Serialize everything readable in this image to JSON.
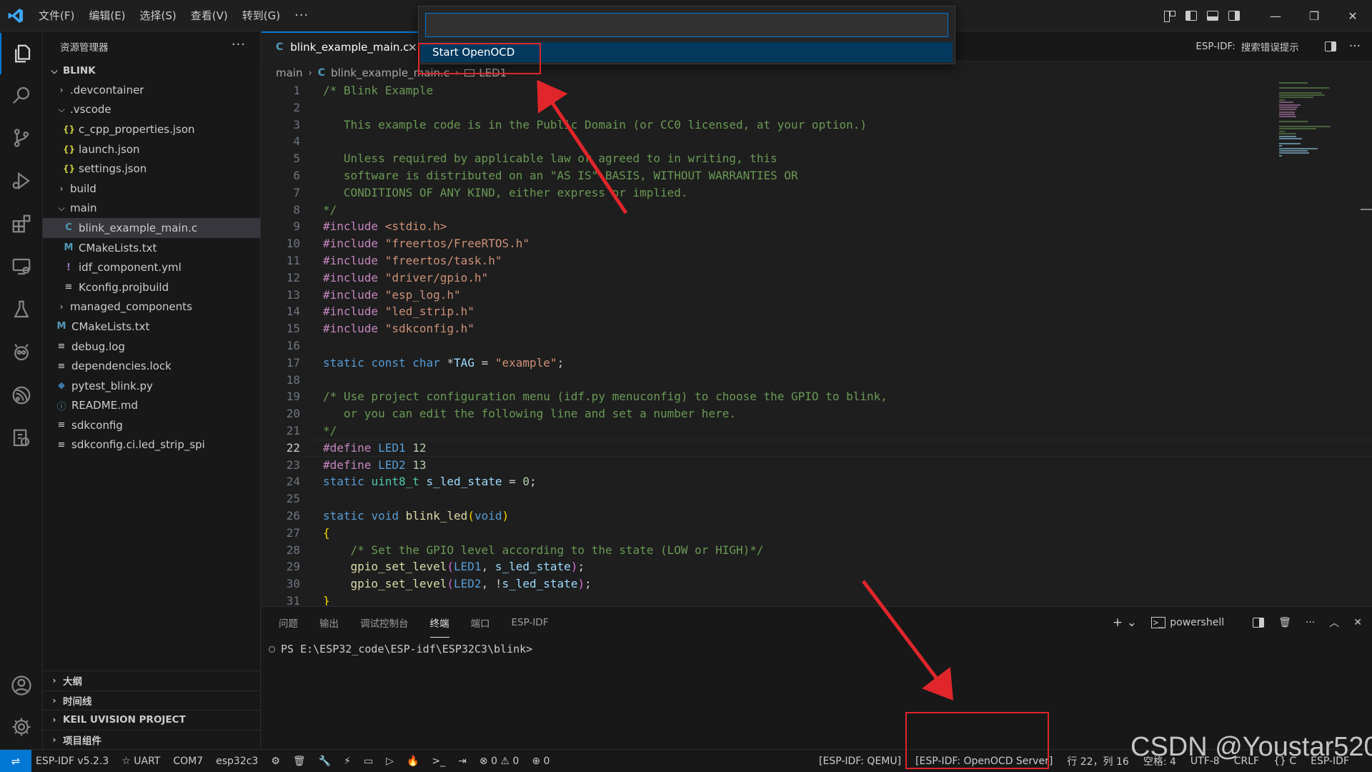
{
  "titlebar": {
    "menu": [
      "文件(F)",
      "编辑(E)",
      "选择(S)",
      "查看(V)",
      "转到(G)",
      "···"
    ],
    "window_controls": [
      "—",
      "❐",
      "✕"
    ]
  },
  "palette": {
    "input_value": "",
    "item": "Start OpenOCD"
  },
  "sidebar": {
    "title": "资源管理器",
    "more": "···",
    "root": "BLINK",
    "tree": [
      {
        "label": ".devcontainer",
        "type": "folder",
        "depth": 1,
        "open": false
      },
      {
        "label": ".vscode",
        "type": "folder",
        "depth": 1,
        "open": true
      },
      {
        "label": "c_cpp_properties.json",
        "type": "json",
        "depth": 2
      },
      {
        "label": "launch.json",
        "type": "json",
        "depth": 2
      },
      {
        "label": "settings.json",
        "type": "json",
        "depth": 2
      },
      {
        "label": "build",
        "type": "folder",
        "depth": 1,
        "open": false
      },
      {
        "label": "main",
        "type": "folder",
        "depth": 1,
        "open": true
      },
      {
        "label": "blink_example_main.c",
        "type": "c",
        "depth": 2,
        "selected": true
      },
      {
        "label": "CMakeLists.txt",
        "type": "m",
        "depth": 2
      },
      {
        "label": "idf_component.yml",
        "type": "y",
        "depth": 2
      },
      {
        "label": "Kconfig.projbuild",
        "type": "txt",
        "depth": 2
      },
      {
        "label": "managed_components",
        "type": "folder",
        "depth": 1,
        "open": false
      },
      {
        "label": "CMakeLists.txt",
        "type": "m",
        "depth": 1
      },
      {
        "label": "debug.log",
        "type": "txt",
        "depth": 1
      },
      {
        "label": "dependencies.lock",
        "type": "txt",
        "depth": 1
      },
      {
        "label": "pytest_blink.py",
        "type": "py",
        "depth": 1
      },
      {
        "label": "README.md",
        "type": "info",
        "depth": 1
      },
      {
        "label": "sdkconfig",
        "type": "txt",
        "depth": 1
      },
      {
        "label": "sdkconfig.ci.led_strip_spi",
        "type": "txt",
        "depth": 1
      }
    ],
    "bottom_sections": [
      "大纲",
      "时间线",
      "KEIL UVISION PROJECT",
      "项目组件"
    ]
  },
  "editor": {
    "tab": {
      "icon": "C",
      "label": "blink_example_main.c",
      "close": "✕"
    },
    "tab_right": {
      "label": "ESP-IDF:",
      "action": "搜索错误提示",
      "more": "···"
    },
    "breadcrumb": [
      "main",
      "blink_example_main.c",
      "LED1"
    ],
    "current_line": 22,
    "lines": [
      {
        "n": "1",
        "html": "<span class=\"cm\">/* Blink Example</span>"
      },
      {
        "n": "2",
        "html": ""
      },
      {
        "n": "3",
        "html": "<span class=\"cm\">   This example code is in the Public Domain (or CC0 licensed, at your option.)</span>"
      },
      {
        "n": "4",
        "html": ""
      },
      {
        "n": "5",
        "html": "<span class=\"cm\">   Unless required by applicable law or agreed to in writing, this</span>"
      },
      {
        "n": "6",
        "html": "<span class=\"cm\">   software is distributed on an \"AS IS\" BASIS, WITHOUT WARRANTIES OR</span>"
      },
      {
        "n": "7",
        "html": "<span class=\"cm\">   CONDITIONS OF ANY KIND, either express or implied.</span>"
      },
      {
        "n": "8",
        "html": "<span class=\"cm\">*/</span>"
      },
      {
        "n": "9",
        "html": "<span class=\"pp\">#include</span> <span class=\"st\">&lt;stdio.h&gt;</span>"
      },
      {
        "n": "10",
        "html": "<span class=\"pp\">#include</span> <span class=\"st\">\"freertos/FreeRTOS.h\"</span>"
      },
      {
        "n": "11",
        "html": "<span class=\"pp\">#include</span> <span class=\"st\">\"freertos/task.h\"</span>"
      },
      {
        "n": "12",
        "html": "<span class=\"pp\">#include</span> <span class=\"st\">\"driver/gpio.h\"</span>"
      },
      {
        "n": "13",
        "html": "<span class=\"pp\">#include</span> <span class=\"st\">\"esp_log.h\"</span>"
      },
      {
        "n": "14",
        "html": "<span class=\"pp\">#include</span> <span class=\"st\">\"led_strip.h\"</span>"
      },
      {
        "n": "15",
        "html": "<span class=\"pp\">#include</span> <span class=\"st\">\"sdkconfig.h\"</span>"
      },
      {
        "n": "16",
        "html": ""
      },
      {
        "n": "17",
        "html": "<span class=\"kw\">static</span> <span class=\"kw\">const</span> <span class=\"kw\">char</span> *<span class=\"va\">TAG</span> = <span class=\"st\">\"example\"</span>;"
      },
      {
        "n": "18",
        "html": ""
      },
      {
        "n": "19",
        "html": "<span class=\"cm\">/* Use project configuration menu (idf.py menuconfig) to choose the GPIO to blink,</span>"
      },
      {
        "n": "20",
        "html": "<span class=\"cm\">   or you can edit the following line and set a number here.</span>"
      },
      {
        "n": "21",
        "html": "<span class=\"cm\">*/</span>"
      },
      {
        "n": "22",
        "html": "<span class=\"pp\">#define</span> <span class=\"mc\">LED1</span> <span class=\"nm\">12</span>"
      },
      {
        "n": "23",
        "html": "<span class=\"pp\">#define</span> <span class=\"mc\">LED2</span> <span class=\"nm\">13</span>"
      },
      {
        "n": "24",
        "html": "<span class=\"kw\">static</span> <span class=\"ty\">uint8_t</span> <span class=\"va\">s_led_state</span> = <span class=\"nm\">0</span>;"
      },
      {
        "n": "25",
        "html": ""
      },
      {
        "n": "26",
        "html": "<span class=\"kw\">static</span> <span class=\"kw\">void</span> <span class=\"fn\">blink_led</span><span class=\"br\">(</span><span class=\"kw\">void</span><span class=\"br\">)</span>"
      },
      {
        "n": "27",
        "html": "<span class=\"br\">{</span>"
      },
      {
        "n": "28",
        "html": "    <span class=\"cm\">/* Set the GPIO level according to the state (LOW or HIGH)*/</span>"
      },
      {
        "n": "29",
        "html": "    <span class=\"fn\">gpio_set_level</span><span class=\"br2\">(</span><span class=\"mc\">LED1</span>, <span class=\"va\">s_led_state</span><span class=\"br2\">)</span>;"
      },
      {
        "n": "30",
        "html": "    <span class=\"fn\">gpio_set_level</span><span class=\"br2\">(</span><span class=\"mc\">LED2</span>, !<span class=\"va\">s_led_state</span><span class=\"br2\">)</span>;"
      },
      {
        "n": "31",
        "html": "<span class=\"br\">}</span>"
      }
    ]
  },
  "panel": {
    "tabs": [
      "问题",
      "输出",
      "调试控制台",
      "终端",
      "端口",
      "ESP-IDF"
    ],
    "active_tab": "终端",
    "right": {
      "add": "+ ⌄",
      "shell": "powershell"
    },
    "terminal_line": "PS E:\\ESP32_code\\ESP-idf\\ESP32C3\\blink>"
  },
  "statusbar": {
    "remote": "⇌",
    "left": [
      "ESP-IDF v5.2.3",
      "☆ UART",
      "COM7",
      "esp32c3",
      "⚙",
      "🗑",
      "🔧",
      "⚡",
      "▭",
      "▷",
      "🔥",
      ">_",
      "⇥",
      "⊗ 0 ⚠ 0",
      "⊕ 0"
    ],
    "right": [
      "[ESP-IDF: QEMU]",
      "[ESP-IDF: OpenOCD Server]",
      "行 22，列 16",
      "空格: 4",
      "UTF-8",
      "CRLF",
      "{} C",
      "ESP-IDF"
    ]
  },
  "watermark": "CSDN @Youstar520"
}
